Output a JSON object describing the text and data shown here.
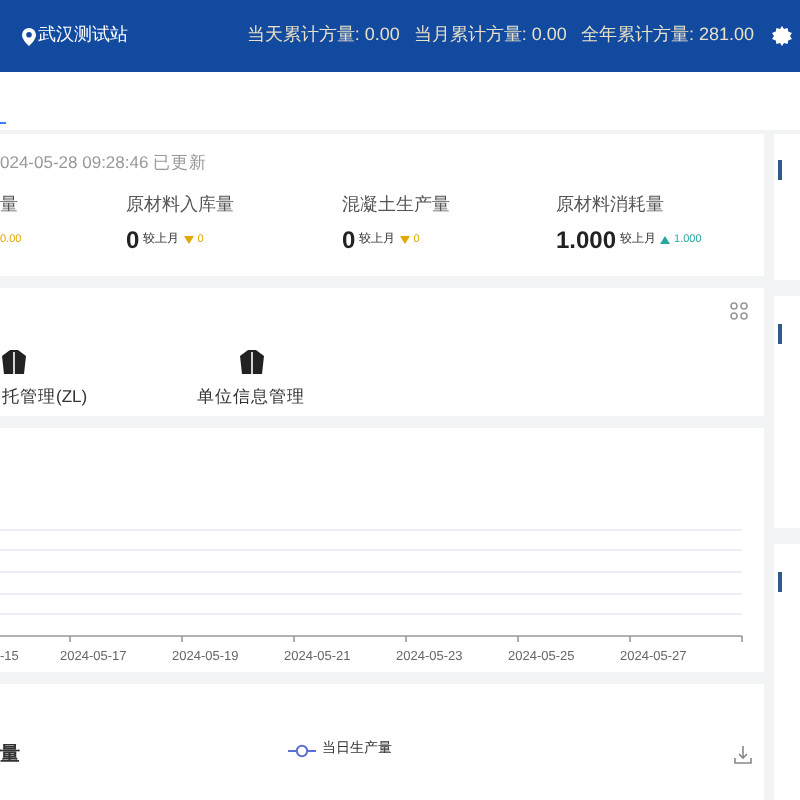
{
  "header": {
    "station": "武汉测试站",
    "totals": [
      {
        "label": "当天累计方量:",
        "value": "0.00"
      },
      {
        "label": "当月累计方量:",
        "value": "0.00"
      },
      {
        "label": "全年累计方量:",
        "value": "281.00"
      }
    ]
  },
  "stats": {
    "updated": "024-05-28 09:28:46 已更新",
    "items": [
      {
        "label": "量",
        "rising": false,
        "delta": "0.00"
      },
      {
        "label": "原材料入库量",
        "value": "0",
        "compare": "较上月",
        "rising": false,
        "delta": "0"
      },
      {
        "label": "混凝土生产量",
        "value": "0",
        "compare": "较上月",
        "rising": false,
        "delta": "0"
      },
      {
        "label": "原材料消耗量",
        "value": "1.000",
        "compare": "较上月",
        "rising": true,
        "delta": "1.000"
      }
    ]
  },
  "shortcuts": [
    {
      "label": "托管理(ZL)"
    },
    {
      "label": "单位信息管理"
    }
  ],
  "trend_chart": {
    "x_labels": [
      "-15",
      "2024-05-17",
      "2024-05-19",
      "2024-05-21",
      "2024-05-23",
      "2024-05-25",
      "2024-05-27"
    ]
  },
  "production_chart": {
    "title": "量",
    "legend": "当日生产量"
  }
}
